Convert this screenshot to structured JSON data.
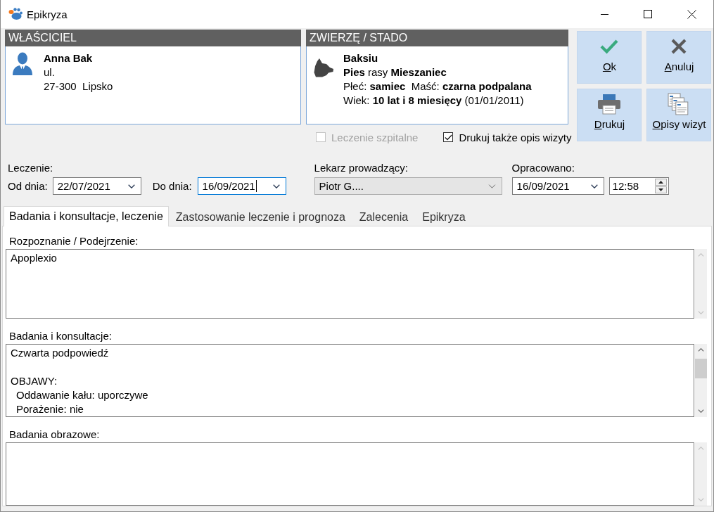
{
  "window": {
    "title": "Epikryza"
  },
  "owner_panel": {
    "title": "WŁAŚCICIEL",
    "name": "Anna Bak",
    "lines": [
      "ul.",
      "27-300  Lipsko"
    ]
  },
  "animal_panel": {
    "title": "ZWIERZĘ / STADO",
    "name": "Baksiu",
    "lines": [
      "**Pies** rasy **Mieszaniec**",
      "Płeć: **samiec**  Maść: **czarna podpalana**",
      "Wiek: **10 lat i 8 miesięcy** (01/01/2011)"
    ]
  },
  "buttons": [
    {
      "kind": "ok",
      "label": "Ok"
    },
    {
      "kind": "cancel",
      "label": "Anuluj"
    },
    {
      "kind": "print",
      "label": "Drukuj"
    },
    {
      "kind": "documents",
      "label": "Opisy wizyt"
    }
  ],
  "options": [
    {
      "label": "Leczenie szpitalne",
      "checked": false,
      "disabled": true
    },
    {
      "label": "Drukuj także opis wizyty",
      "checked": true,
      "disabled": false
    }
  ],
  "treatment": {
    "label": "Leczenie:",
    "from": {
      "label": "Od dnia:",
      "value": "22/07/2021",
      "focused": false
    },
    "to": {
      "label": "Do dnia:",
      "value": "16/09/2021",
      "focused": true
    }
  },
  "doctor": {
    "label": "Lekarz prowadzący:",
    "value": "Piotr G...."
  },
  "prepared": {
    "label": "Opracowano:",
    "date": "16/09/2021",
    "time": "12:58"
  },
  "tabs": [
    {
      "label": "Badania i konsultacje, leczenie",
      "selected": true
    },
    {
      "label": "Zastosowanie leczenie i prognoza",
      "selected": false
    },
    {
      "label": "Zalecenia",
      "selected": false
    },
    {
      "label": "Epikryza",
      "selected": false
    }
  ],
  "sections": [
    {
      "label": "Rozpoznanie / Podejrzenie:",
      "scrollable": false,
      "lines": [
        {
          "text": "Apoplexio"
        }
      ]
    },
    {
      "label": "Badania i konsultacje:",
      "scrollable": true,
      "lines": [
        {
          "text": "Czwarta podpowiedź"
        },
        {
          "text": "OBJAWY:",
          "children": [
            {
              "text": "Oddawanie kału: uporczywe"
            },
            {
              "text": "Porażenie: nie"
            }
          ]
        }
      ]
    },
    {
      "label": "Badania obrazowe:",
      "scrollable": false
    }
  ]
}
